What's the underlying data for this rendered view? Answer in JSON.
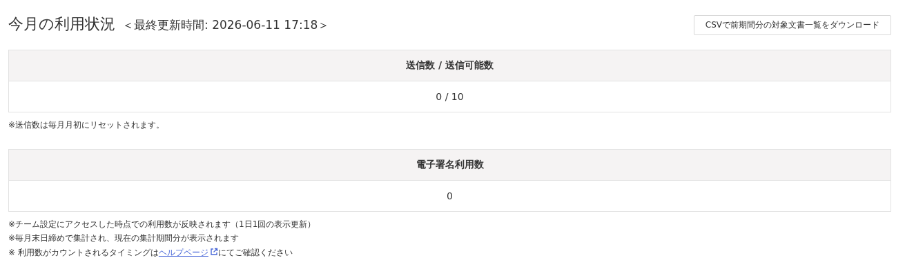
{
  "title": "今月の利用状況",
  "last_updated": "＜最終更新時間: 2026-06-11 17:18＞",
  "download_button": "CSVで前期間分の対象文書一覧をダウンロード",
  "sections": [
    {
      "header": "送信数 / 送信可能数",
      "value": "0 / 10",
      "notes": [
        {
          "text": "※送信数は毎月月初にリセットされます。"
        }
      ]
    },
    {
      "header": "電子署名利用数",
      "value": "0",
      "notes": [
        {
          "text": "※チーム設定にアクセスした時点での利用数が反映されます（1日1回の表示更新）"
        },
        {
          "text": "※毎月末日締めで集計され、現在の集計期間分が表示されます"
        },
        {
          "text": "※ 利用数がカウントされるタイミングは",
          "link": "ヘルプページ",
          "after": "にてご確認ください"
        }
      ]
    }
  ]
}
